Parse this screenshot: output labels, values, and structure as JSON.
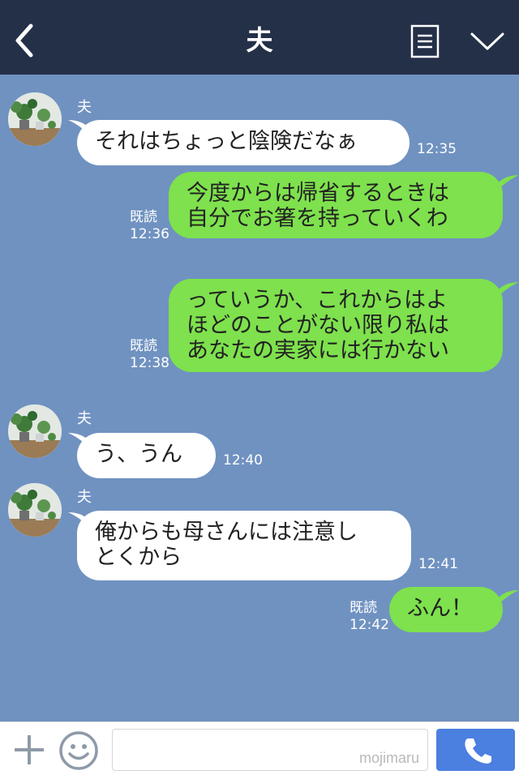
{
  "header": {
    "title": "夫",
    "background": "#243048",
    "icons": [
      "back-chevron-icon",
      "menu-list-icon",
      "collapse-chevron-icon"
    ]
  },
  "chat": {
    "background": "#7092c1",
    "incoming_bubble_color": "#ffffff",
    "outgoing_bubble_color": "#7ee14d",
    "messages": [
      {
        "direction": "in",
        "sender": "夫",
        "text": "それはちょっと陰険だなぁ",
        "time": "12:35"
      },
      {
        "direction": "out",
        "read": "既読",
        "text": "今度からは帰省するときは\n自分でお箸を持っていくわ",
        "time": "12:36"
      },
      {
        "direction": "out",
        "read": "既読",
        "text": "っていうか、これからはよ\nほどのことがない限り私は\nあなたの実家には行かない",
        "time": "12:38"
      },
      {
        "direction": "in",
        "sender": "夫",
        "text": "う、うん",
        "time": "12:40"
      },
      {
        "direction": "in",
        "sender": "夫",
        "text": "俺からも母さんには注意し\nとくから",
        "time": "12:41"
      },
      {
        "direction": "out",
        "read": "既読",
        "text": "ふん！",
        "time": "12:42"
      }
    ]
  },
  "input_bar": {
    "placeholder": "",
    "watermark": "mojimaru",
    "call_button_color": "#4b7fe0",
    "icons": [
      "plus-icon",
      "emoji-icon",
      "phone-icon"
    ]
  }
}
